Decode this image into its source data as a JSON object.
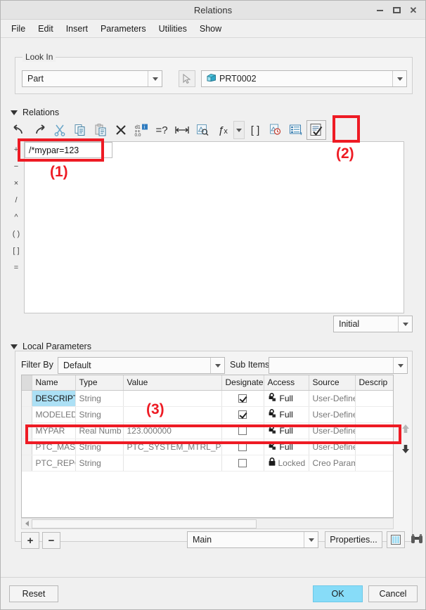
{
  "window": {
    "title": "Relations",
    "buttons": {
      "minimize": "minimize-icon",
      "maximize": "maximize-icon",
      "close": "close-icon"
    }
  },
  "menubar": [
    {
      "label": "File"
    },
    {
      "label": "Edit"
    },
    {
      "label": "Insert"
    },
    {
      "label": "Parameters"
    },
    {
      "label": "Utilities"
    },
    {
      "label": "Show"
    }
  ],
  "look_in": {
    "legend": "Look In",
    "type_value": "Part",
    "picker_icon": "arrow-cursor-icon",
    "model_value": "PRT0002",
    "model_icon": "part-cube-icon"
  },
  "relations": {
    "section_label": "Relations",
    "toolbar": [
      {
        "name": "undo-icon",
        "glyph": "↶"
      },
      {
        "name": "redo-icon",
        "glyph": "↷"
      },
      {
        "name": "cut-icon",
        "glyph": "✂"
      },
      {
        "name": "copy-icon",
        "glyph": "⧉"
      },
      {
        "name": "paste-icon",
        "glyph": "ὌB"
      },
      {
        "name": "delete-icon",
        "glyph": "✕"
      },
      {
        "name": "switch-dimensions-icon",
        "glyph": "d1"
      },
      {
        "name": "verify-relations-icon",
        "glyph": "=?"
      },
      {
        "name": "dimension-icon",
        "glyph": "↔"
      },
      {
        "name": "insert-from-model-icon",
        "glyph": "▣"
      },
      {
        "name": "function-icon",
        "glyph": "ƒx"
      },
      {
        "name": "function-dropdown-icon",
        "glyph": "▼"
      },
      {
        "name": "units-icon",
        "glyph": "[ ]"
      },
      {
        "name": "history-icon",
        "glyph": "⏱"
      },
      {
        "name": "relations-list-icon",
        "glyph": "☰"
      },
      {
        "name": "check-relations-icon",
        "glyph": "☑"
      }
    ],
    "operators": [
      "+",
      "−",
      "×",
      "/",
      "^",
      "( )",
      "[ ]",
      "="
    ],
    "text_value": "/*mypar=123",
    "initial_value": "Initial"
  },
  "local_parameters": {
    "section_label": "Local Parameters",
    "filter_by_label": "Filter By",
    "filter_by_value": "Default",
    "sub_items_label": "Sub Items",
    "sub_items_value": "",
    "columns": [
      "Name",
      "Type",
      "Value",
      "Designate",
      "Access",
      "Source",
      "Descrip"
    ],
    "rows": [
      {
        "name": "DESCRIPTIO",
        "type": "String",
        "value": "",
        "designate": true,
        "access": "Full",
        "access_icon": "lock-open-icon",
        "source": "User-Define",
        "description": "",
        "selected": true
      },
      {
        "name": "MODELED_",
        "type": "String",
        "value": "",
        "designate": true,
        "access": "Full",
        "access_icon": "lock-open-icon",
        "source": "User-Define",
        "description": "",
        "selected": false
      },
      {
        "name": "MYPAR",
        "type": "Real Numb",
        "value": "123.000000",
        "designate": false,
        "access": "Full",
        "access_icon": "lock-open-icon",
        "source": "User-Define",
        "description": "",
        "selected": false
      },
      {
        "name": "PTC_MASTE",
        "type": "String",
        "value": "PTC_SYSTEM_MTRL_PROPS",
        "designate": false,
        "access": "Full",
        "access_icon": "lock-open-icon",
        "source": "User-Define",
        "description": "",
        "selected": false
      },
      {
        "name": "PTC_REPOR",
        "type": "String",
        "value": "",
        "designate": false,
        "access": "Locked",
        "access_icon": "lock-closed-icon",
        "source": "Creo Param",
        "description": "",
        "selected": false
      }
    ],
    "move_up_icon": "move-up-arrow-icon",
    "move_down_icon": "move-down-arrow-icon",
    "add_label": "+",
    "remove_label": "−",
    "main_value": "Main",
    "properties_label": "Properties...",
    "columns_icon": "columns-table-icon",
    "find_icon": "binoculars-icon"
  },
  "footer": {
    "reset_label": "Reset",
    "ok_label": "OK",
    "cancel_label": "Cancel"
  },
  "annotations": [
    {
      "id": "1",
      "label": "(1)"
    },
    {
      "id": "2",
      "label": "(2)"
    },
    {
      "id": "3",
      "label": "(3)"
    }
  ],
  "colors": {
    "accent_ok": "#87dcf8",
    "annotation_red": "#ee1b24",
    "row_select_blue": "#ace0f5",
    "window_bg": "#f0f0f0"
  }
}
